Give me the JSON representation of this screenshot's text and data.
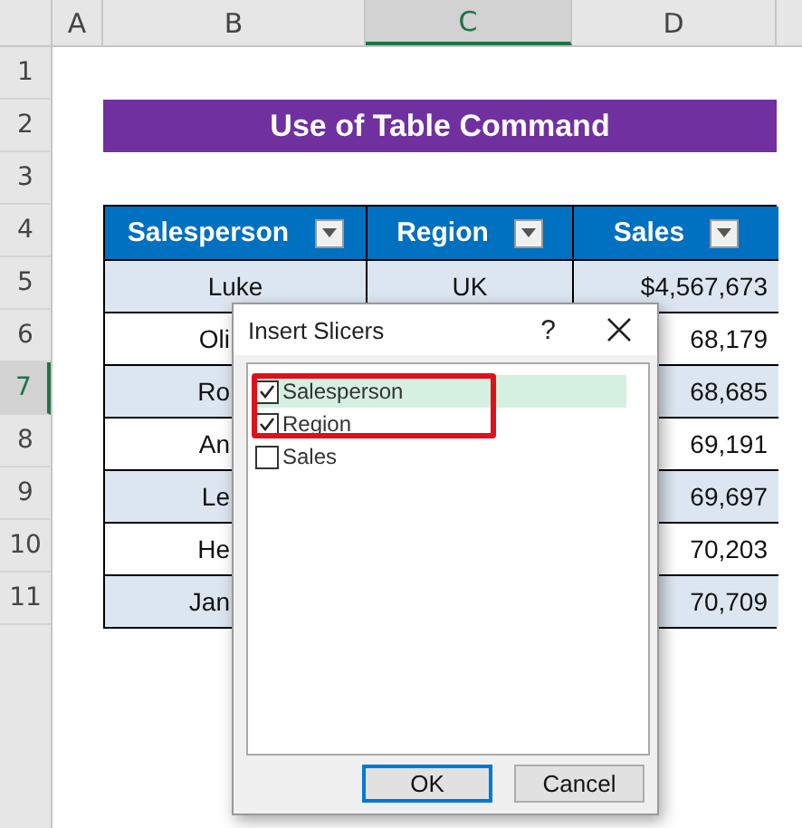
{
  "columns": [
    {
      "label": "A",
      "selected": false
    },
    {
      "label": "B",
      "selected": false
    },
    {
      "label": "C",
      "selected": true
    },
    {
      "label": "D",
      "selected": false
    }
  ],
  "row_numbers": [
    {
      "label": "1",
      "selected": false
    },
    {
      "label": "2",
      "selected": false
    },
    {
      "label": "3",
      "selected": false
    },
    {
      "label": "4",
      "selected": false
    },
    {
      "label": "5",
      "selected": false
    },
    {
      "label": "6",
      "selected": false
    },
    {
      "label": "7",
      "selected": true
    },
    {
      "label": "8",
      "selected": false
    },
    {
      "label": "9",
      "selected": false
    },
    {
      "label": "10",
      "selected": false
    },
    {
      "label": "11",
      "selected": false
    }
  ],
  "title": "Use of Table Command",
  "table": {
    "headers": [
      "Salesperson",
      "Region",
      "Sales"
    ],
    "rows": [
      {
        "salesperson": "Luke",
        "region": "UK",
        "sales": "$4,567,673"
      },
      {
        "salesperson": "Oli",
        "sales": "68,179"
      },
      {
        "salesperson": "Ro",
        "sales": "68,685"
      },
      {
        "salesperson": "An",
        "sales": "69,191"
      },
      {
        "salesperson": "Le",
        "sales": "69,697"
      },
      {
        "salesperson": "He",
        "sales": "70,203"
      },
      {
        "salesperson": "Jan",
        "sales": "70,709"
      }
    ]
  },
  "dialog": {
    "title": "Insert Slicers",
    "help": "?",
    "items": [
      {
        "label": "Salesperson",
        "checked": true,
        "selected": true
      },
      {
        "label": "Region",
        "checked": true,
        "selected": false
      },
      {
        "label": "Sales",
        "checked": false,
        "selected": false
      }
    ],
    "buttons": [
      {
        "label": "OK",
        "default": true
      },
      {
        "label": "Cancel",
        "default": false
      }
    ]
  }
}
